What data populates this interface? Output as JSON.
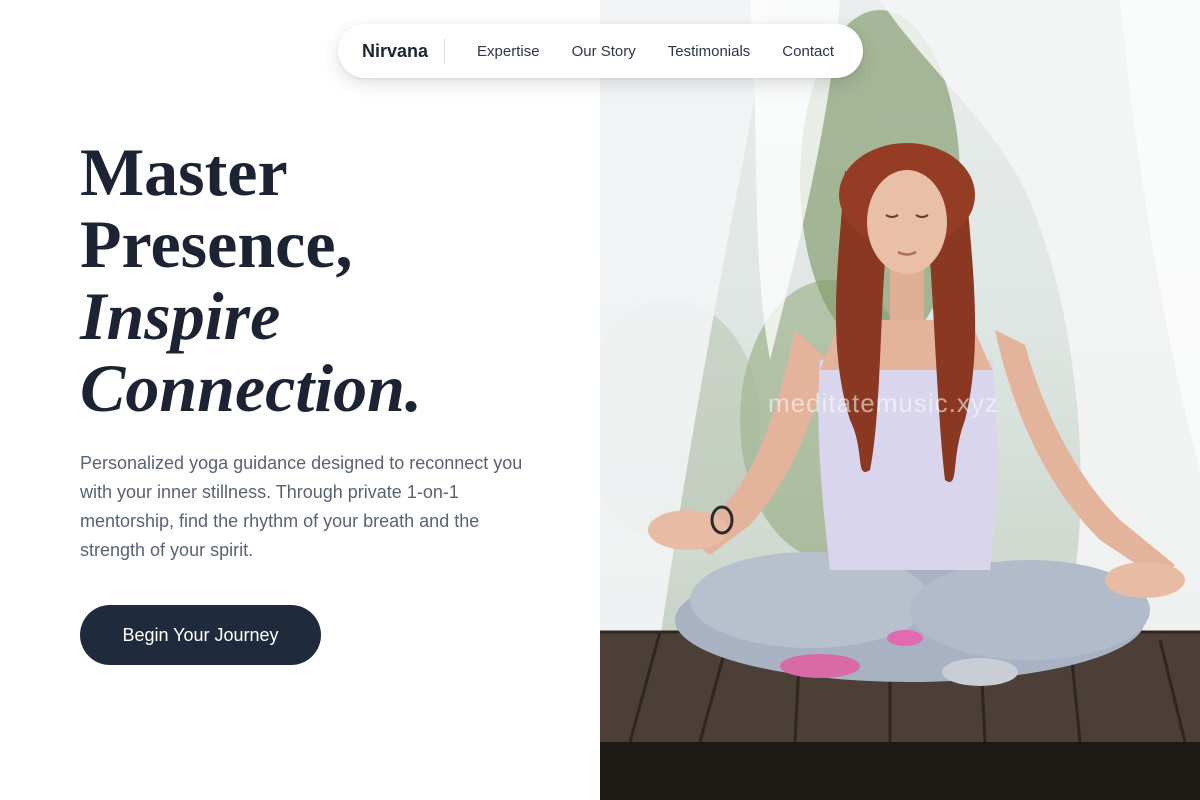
{
  "nav": {
    "brand": "Nirvana",
    "links": [
      "Expertise",
      "Our Story",
      "Testimonials",
      "Contact"
    ]
  },
  "hero": {
    "title_line1": "Master",
    "title_line2": "Presence,",
    "title_line3": "Inspire",
    "title_line4": "Connection.",
    "description": "Personalized yoga guidance designed to reconnect you with your inner stillness. Through private 1-on-1 mentorship, find the rhythm of your breath and the strength of your spirit.",
    "cta_label": "Begin Your Journey"
  },
  "photo": {
    "alt": "Woman meditating cross-legged on a wooden deck surrounded by sheer white curtains",
    "watermark": "meditatemusic.xyz"
  },
  "colors": {
    "primary_dark": "#1f2a3c",
    "heading_text": "#1c2433",
    "body_text": "#5a6271",
    "background": "#ffffff"
  }
}
